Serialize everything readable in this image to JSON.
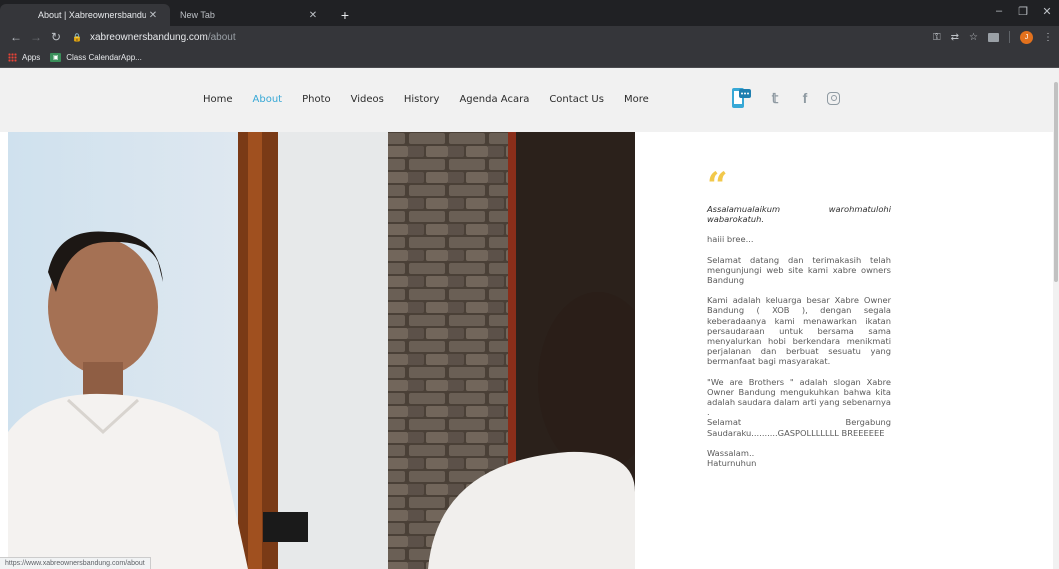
{
  "browser": {
    "tabs": [
      {
        "title": "About | Xabreownersbandung",
        "active": true
      },
      {
        "title": "New Tab",
        "active": false
      }
    ],
    "new_tab_label": "+",
    "address": {
      "host": "xabreownersbandung.com",
      "path": "/about"
    },
    "bookmarks": [
      {
        "label": "Apps",
        "icon": "apps-grid-icon"
      },
      {
        "label": "Class CalendarApp...",
        "icon": "calendar-icon"
      }
    ],
    "profile_initial": "J",
    "status_url": "https://www.xabreownersbandung.com/about"
  },
  "site": {
    "nav": [
      "Home",
      "About",
      "Photo",
      "Videos",
      "History",
      "Agenda Acara",
      "Contact Us",
      "More"
    ],
    "active_nav": "About",
    "socials": [
      "phone-app-icon",
      "twitter-icon",
      "facebook-icon",
      "instagram-icon"
    ]
  },
  "about": {
    "quote_mark": "“",
    "greeting": "Assalamualaikum warohmatulohi wabarokatuh.",
    "p1": "haiii bree...",
    "p2": "Selamat datang dan terimakasih telah mengunjungi web site kami xabre owners Bandung",
    "p3": "Kami adalah keluarga besar Xabre Owner Bandung ( XOB ), dengan segala keberadaanya kami menawarkan ikatan persaudaraan untuk bersama sama menyalurkan hobi berkendara menikmati perjalanan dan berbuat sesuatu yang bermanfaat bagi masyarakat.",
    "p4a": "\"We are Brothers \" adalah slogan Xabre Owner Bandung mengukuhkan bahwa kita adalah saudara dalam arti yang sebenarnya .",
    "p4b": "Selamat Bergabung Saudaraku..........GASPOLLLLLLL BREEEEEE",
    "closing1": "Wassalam..",
    "closing2": "Haturnuhun"
  },
  "colors": {
    "accent": "#37a8d6",
    "quote": "#f2c84b"
  }
}
